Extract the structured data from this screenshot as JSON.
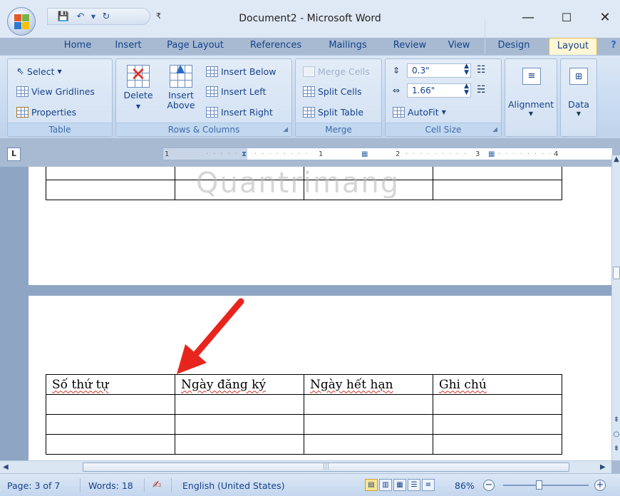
{
  "window": {
    "title": "Document2 - Microsoft Word",
    "minimize_label": "—",
    "maximize_label": "☐",
    "close_label": "✕"
  },
  "quick_access": {
    "save_icon": "💾",
    "undo_icon": "↶",
    "redo_icon": "↻",
    "customize_icon": "₹"
  },
  "tabs": [
    "Home",
    "Insert",
    "Page Layout",
    "References",
    "Mailings",
    "Review",
    "View",
    "Design",
    "Layout"
  ],
  "active_tab": "Layout",
  "ribbon": {
    "table_group": {
      "label": "Table",
      "select": "Select",
      "view_gridlines": "View Gridlines",
      "properties": "Properties"
    },
    "rows_columns_group": {
      "label": "Rows & Columns",
      "delete": "Delete",
      "insert_above_1": "Insert",
      "insert_above_2": "Above",
      "insert_below": "Insert Below",
      "insert_left": "Insert Left",
      "insert_right": "Insert Right"
    },
    "merge_group": {
      "label": "Merge",
      "merge_cells": "Merge Cells",
      "split_cells": "Split Cells",
      "split_table": "Split Table"
    },
    "cell_size_group": {
      "label": "Cell Size",
      "height_value": "0.3\"",
      "width_value": "1.66\"",
      "autofit": "AutoFit"
    },
    "alignment_group": {
      "label": "Alignment"
    },
    "data_group": {
      "label": "Data"
    }
  },
  "ruler": {
    "tab_selector": "L",
    "marks": [
      "1",
      "1",
      "2",
      "3",
      "4"
    ]
  },
  "document": {
    "watermark": "Quantrimang",
    "table_headers": [
      "Số thứ tự",
      "Ngày đăng ký",
      "Ngày hết hạn",
      "Ghi chú"
    ]
  },
  "scroll": {
    "thumb_glyph": "|||"
  },
  "status": {
    "page": "Page: 3 of 7",
    "words": "Words: 18",
    "language": "English (United States)",
    "zoom": "86%",
    "zoom_out": "−",
    "zoom_in": "+"
  },
  "colors": {
    "ribbon_bg": "#c6d9f1",
    "active_tab_bg": "#fff6d5",
    "doc_bg": "#8ea6c3",
    "arrow": "#e8251d",
    "spellcheck": "#d62d20"
  }
}
